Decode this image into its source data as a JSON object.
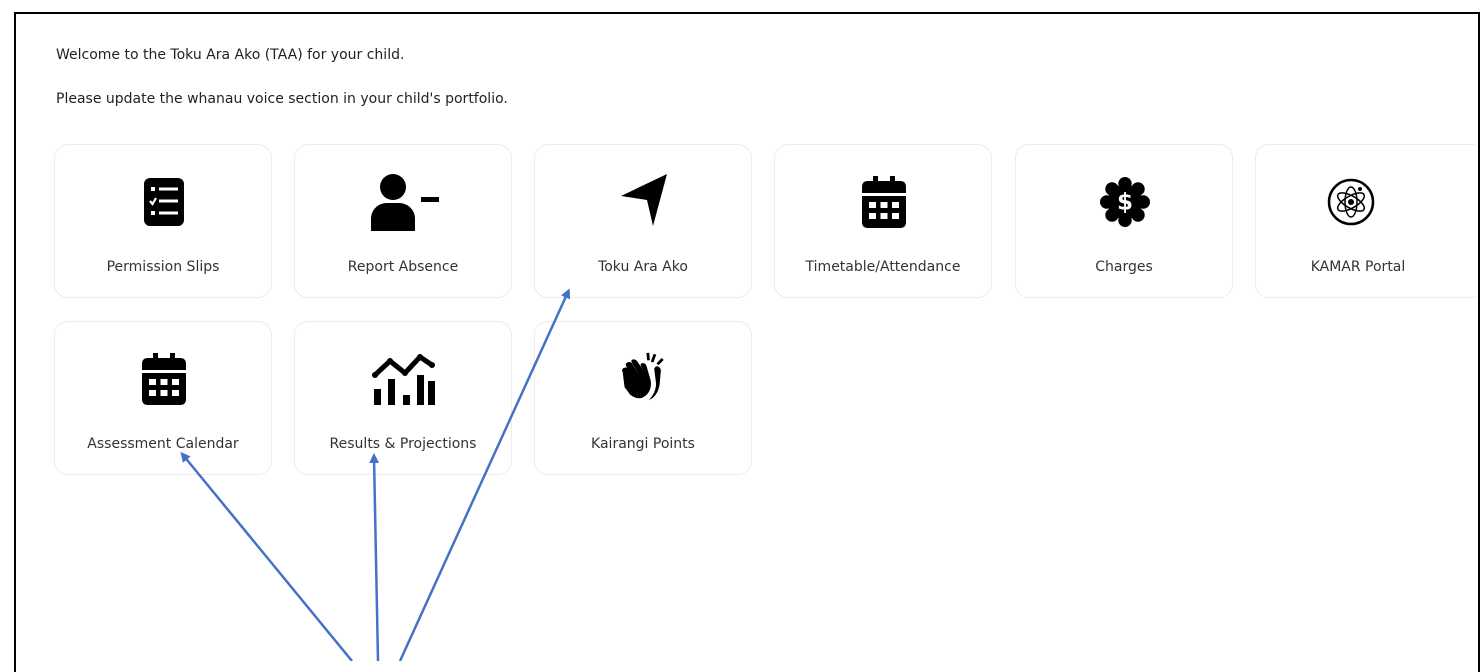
{
  "intro": {
    "line1": "Welcome to the Toku Ara Ako (TAA) for your child.",
    "line2": "Please update the whanau voice section in your child's portfolio."
  },
  "tiles": [
    {
      "label": "Permission Slips",
      "icon": "checklist-icon"
    },
    {
      "label": "Report Absence",
      "icon": "user-minus-icon"
    },
    {
      "label": "Toku Ara Ako",
      "icon": "location-arrow-icon"
    },
    {
      "label": "Timetable/Attendance",
      "icon": "calendar-icon"
    },
    {
      "label": "Charges",
      "icon": "dollar-badge-icon"
    },
    {
      "label": "KAMAR Portal",
      "icon": "kamar-logo-icon"
    },
    {
      "label": "Assessment Calendar",
      "icon": "calendar-icon"
    },
    {
      "label": "Results & Projections",
      "icon": "chart-line-icon"
    },
    {
      "label": "Kairangi Points",
      "icon": "clapping-hands-icon"
    }
  ],
  "annotation": {
    "color": "#4472c4"
  }
}
